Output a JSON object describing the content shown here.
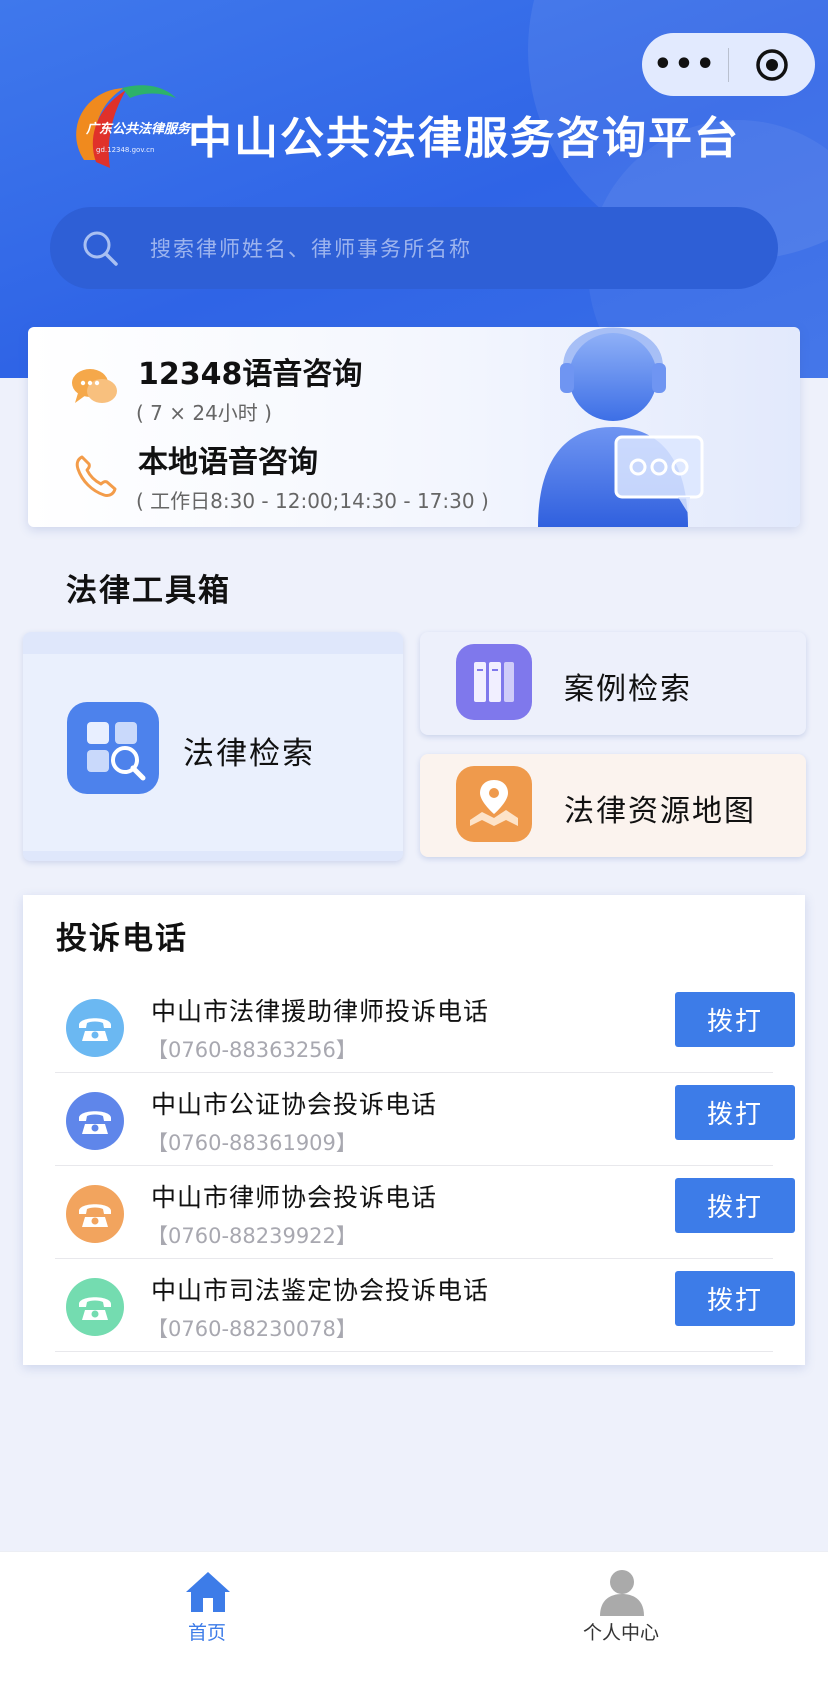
{
  "header": {
    "logo_text": "广东公共法律服务",
    "logo_sub": "gd.12348.gov.cn",
    "title": "中山公共法律服务咨询平台",
    "capsule_more": "•••",
    "search_placeholder": "搜索律师姓名、律师事务所名称"
  },
  "consult": {
    "items": [
      {
        "title": "12348语音咨询",
        "sub": "( 7 × 24小时 )",
        "icon": "chat-bubbles-icon"
      },
      {
        "title": "本地语音咨询",
        "sub": "( 工作日8:30 - 12:00;14:30 - 17:30 )",
        "icon": "phone-icon"
      }
    ]
  },
  "toolbox": {
    "title": "法律工具箱",
    "law_search": "法律检索",
    "case_search": "案例检索",
    "resource_map": "法律资源地图"
  },
  "complaint": {
    "title": "投诉电话",
    "dial_label": "拨打",
    "items": [
      {
        "name": "中山市法律援助律师投诉电话",
        "number": "【0760-88363256】",
        "color": "#6bb8f2"
      },
      {
        "name": "中山市公证协会投诉电话",
        "number": "【0760-88361909】",
        "color": "#5f86ea"
      },
      {
        "name": "中山市律师协会投诉电话",
        "number": "【0760-88239922】",
        "color": "#f2a45e"
      },
      {
        "name": "中山市司法鉴定协会投诉电话",
        "number": "【0760-88230078】",
        "color": "#74dcb0"
      }
    ]
  },
  "tabbar": {
    "home": "首页",
    "me": "个人中心"
  },
  "colors": {
    "accent": "#3d7ce8",
    "header": "#3f78ec"
  }
}
